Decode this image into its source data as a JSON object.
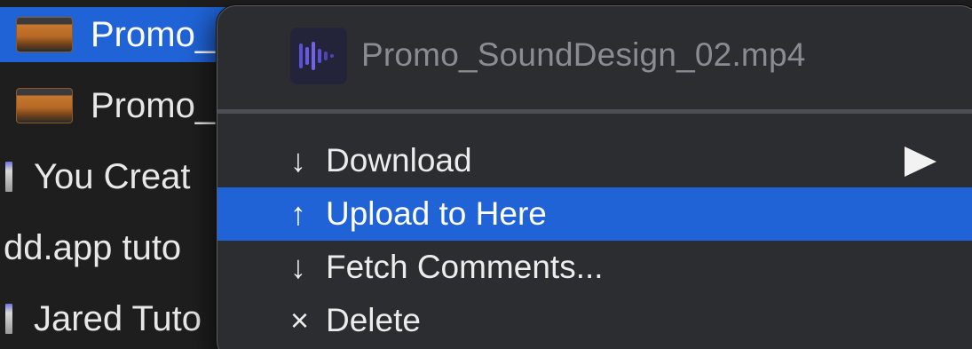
{
  "file_list": {
    "rows": [
      {
        "label": "Promo_",
        "type": "video",
        "selected": true
      },
      {
        "label": "Promo_",
        "type": "video",
        "selected": false
      },
      {
        "label": "You Creat",
        "type": "doc",
        "selected": false
      },
      {
        "label": "dd.app tuto",
        "type": "none",
        "selected": false
      },
      {
        "label": "Jared Tuto",
        "type": "doc",
        "selected": false
      }
    ]
  },
  "context_menu": {
    "header": {
      "title": "Promo_SoundDesign_02.mp4",
      "icon": "audio-waveform-icon"
    },
    "items": [
      {
        "glyph": "↓",
        "label": "Download",
        "has_submenu": true,
        "highlighted": false
      },
      {
        "glyph": "↑",
        "label": "Upload to Here",
        "has_submenu": false,
        "highlighted": true
      },
      {
        "glyph": "↓",
        "label": "Fetch Comments...",
        "has_submenu": false,
        "highlighted": false
      },
      {
        "glyph": "×",
        "label": "Delete",
        "has_submenu": false,
        "highlighted": false
      }
    ]
  },
  "colors": {
    "selection": "#1f63d6",
    "menu_bg": "#2b2d31",
    "window_bg": "#1e1e1e",
    "muted_text": "#8a8c91"
  }
}
